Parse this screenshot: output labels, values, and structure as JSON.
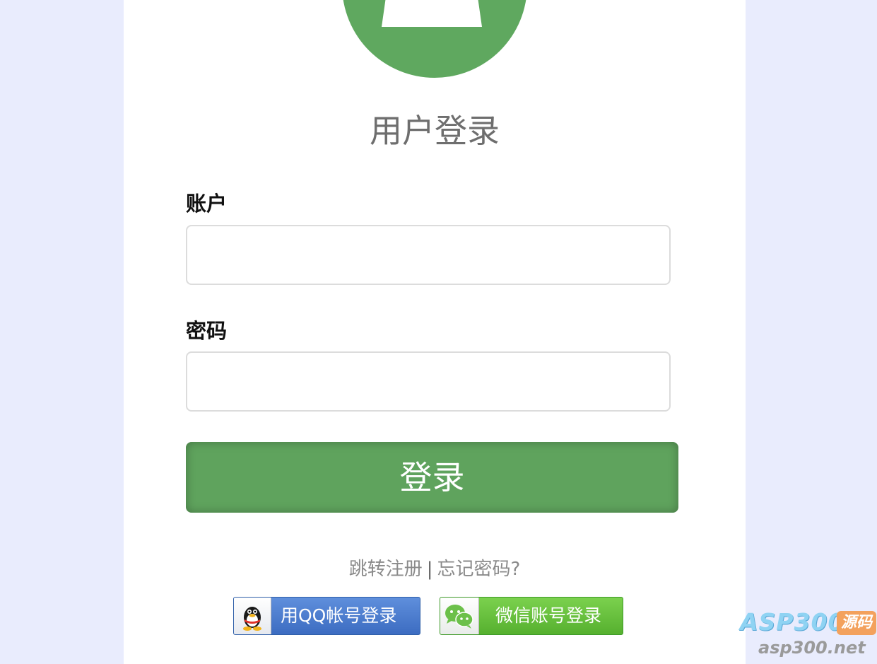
{
  "header": {
    "title": "用户登录",
    "avatar_icon": "user-avatar-icon"
  },
  "form": {
    "account": {
      "label": "账户",
      "value": "",
      "placeholder": ""
    },
    "password": {
      "label": "密码",
      "value": "",
      "placeholder": ""
    },
    "login_button": "登录"
  },
  "links": {
    "register": "跳转注册",
    "separator": "|",
    "forgot": "忘记密码?"
  },
  "social": {
    "qq_label": "用QQ帐号登录",
    "qq_icon": "qq-penguin-icon",
    "wechat_label": "微信账号登录",
    "wechat_icon": "wechat-icon"
  },
  "watermark": {
    "brand": "ASP300",
    "badge": "源码",
    "url": "asp300.net"
  },
  "colors": {
    "background": "#e9ecfd",
    "accent_green": "#5fa35d",
    "qq_blue": "#3c6cc1",
    "wechat_green": "#56b02f"
  }
}
